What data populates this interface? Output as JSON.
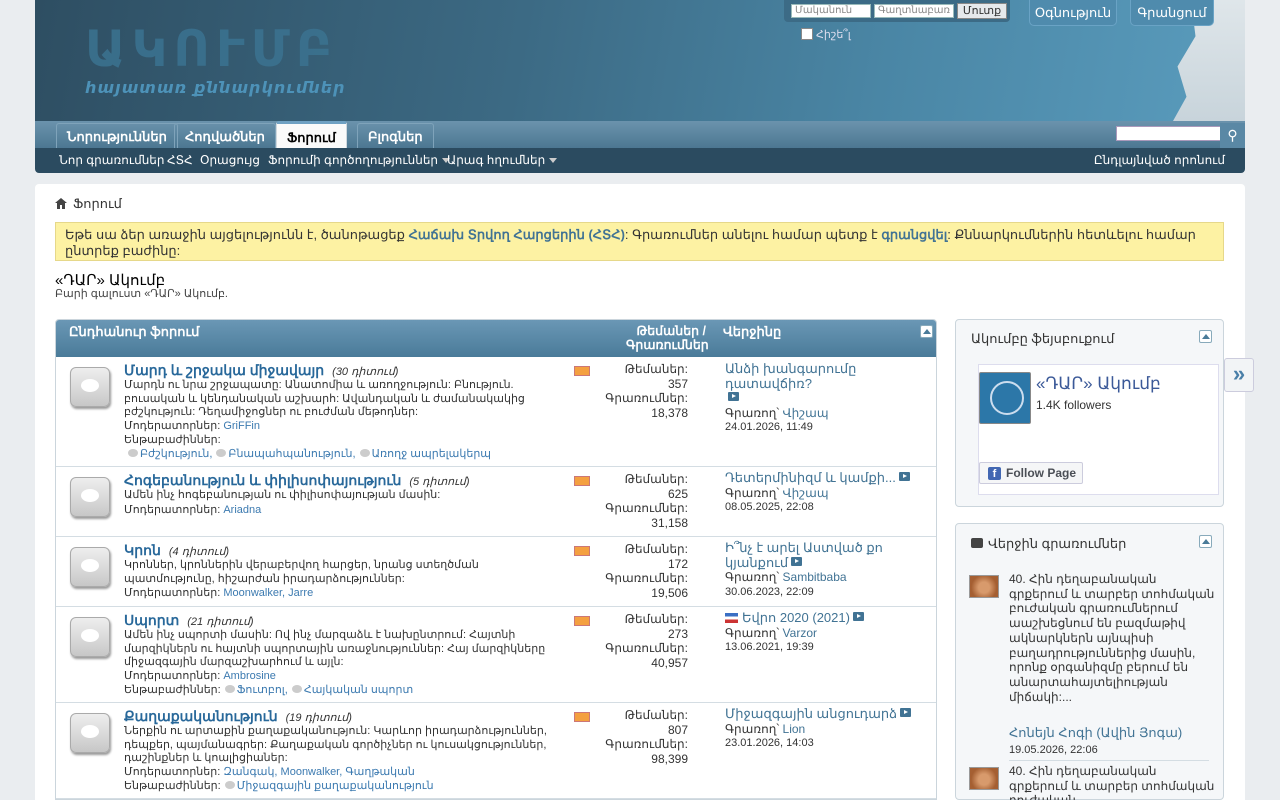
{
  "header": {
    "logo_title": "ԱԿՈՒՄԲ",
    "logo_subtitle": "հայատառ քննարկումներ",
    "login": {
      "username_placeholder": "Մականուն",
      "password_placeholder": "Գաղտնաբառ",
      "login_button": "Մուտք",
      "remember_label": "Հիշե՞լ"
    },
    "help_button": "Օգնություն",
    "register_button": "Գրանցում"
  },
  "nav": {
    "tabs": [
      "Նորություններ",
      "Հոդվածներ",
      "Ֆորում",
      "Բլոգներ"
    ],
    "selected": "Ֆորում",
    "subnav": [
      "Նոր գրառումներ",
      "ՀՏՀ",
      "Օրացույց",
      "Ֆորումի գործողություններ",
      "Արագ հղումներ"
    ],
    "subnav_right": "Ընդլայնված որոնում"
  },
  "breadcrumb": "Ֆորում",
  "notice": {
    "part1": "Եթե սա ձեր առաջին այցելությունն է, ծանոթացեք ",
    "faq_link": "Հաճախ Տրվող Հարցերին (ՀՏՀ)",
    "part2": ": Գրառումներ անելու համար պետք է ",
    "register_link": "գրանցվել",
    "part3": ": Քննարկումներին հետևելու համար ընտրեք բաժինը:"
  },
  "forum_title": "«ԴԱՐ» Ակումբ",
  "welcome_text": "Բարի գալուստ «ԴԱՐ» Ակումբ.",
  "forumlist": {
    "header_title": "Ընդհանուր ֆորում",
    "header_stats": "Թեմաներ / Գրառումներ",
    "header_last": "Վերջինը",
    "topics_label": "Թեմաներ:",
    "posts_label": "Գրառումներ:",
    "moderators_label": "Մոդերատորներ:",
    "subforums_label": "Ենթաբաժիններ:",
    "by_label": "Գրառող՝",
    "rows": [
      {
        "name": "Մարդ և շրջակա միջավայր",
        "viewing": "(30 դիտում)",
        "desc": "Մարդն ու նրա շրջապատը: Անատոմիա և առողջություն: Բնություն. բուսական և կենդանական աշխարհ: Ավանդական և ժամանակակից բժշկություն: Դեղամիջոցներ ու բուժման մեթոդներ:",
        "moderators": "GriFFin",
        "subforums": [
          "Բժշկություն,",
          "Բնապահպանություն,",
          "Առողջ ապրելակերպ"
        ],
        "topics": "357",
        "posts": "18,378",
        "last_title": "Անձի խանգարումը դատավճիռ?",
        "last_user": "Վիշապ",
        "last_date": "24.01.2026, 11:49"
      },
      {
        "name": "Հոգեբանություն և փիլիսոփայություն",
        "viewing": "(5 դիտում)",
        "desc": "Ամեն ինչ հոգեբանության ու փիլիսոփայության մասին:",
        "moderators": "Ariadna",
        "subforums": [],
        "topics": "625",
        "posts": "31,158",
        "last_title": "Դետերմինիզմ և կամքի...",
        "last_user": "Վիշապ",
        "last_date": "08.05.2025, 22:08"
      },
      {
        "name": "Կրոն",
        "viewing": "(4 դիտում)",
        "desc": "Կրոններ, կրոններին վերաբերվող հարցեր, նրանց ստեղծման պատմությունը, հիշարժան իրադարձություններ:",
        "moderators": "Moonwalker, Jarre",
        "subforums": [],
        "topics": "172",
        "posts": "19,506",
        "last_title": "Ի՞նչ է արել Աստված քո կյանքում",
        "last_user": "Sambitbaba",
        "last_date": "30.06.2023, 22:09"
      },
      {
        "name": "Սպորտ",
        "viewing": "(21 դիտում)",
        "desc": "Ամեն ինչ սպորտի մասին: Ով ինչ մարզաձև է նախընտրում: Հայտնի մարզիկներն ու հայտնի սպորտային առաջնություններ: Հայ մարզիկները միջազգային մարզաշխարհում և այլն:",
        "moderators": "Ambrosine",
        "subforums": [
          "Ֆուտբոլ,",
          "Հայկական սպորտ"
        ],
        "topics": "273",
        "posts": "40,957",
        "last_title": "Եվրո 2020 (2021)",
        "last_user": "Varzor",
        "last_date": "13.06.2021, 19:39"
      },
      {
        "name": "Քաղաքականություն",
        "viewing": "(19 դիտում)",
        "desc": "Ներքին ու արտաքին քաղաքականություն: Կարևոր իրադարձություններ, դեպքեր, պայմանագրեր: Քաղաքական գործիչներ ու կուսակցություններ, դաշինքներ և կոալիցիաներ:",
        "moderators": "Զանգակ, Moonwalker, Գաղթական",
        "subforums": [
          "Միջազգային քաղաքականություն"
        ],
        "topics": "807",
        "posts": "98,399",
        "last_title": "Միջազգային անցուդարձ",
        "last_user": "Lion",
        "last_date": "23.01.2026, 14:03"
      }
    ]
  },
  "sidebar": {
    "facebook": {
      "title": "Ակումբը ֆեյսբուքում",
      "page_name": "«ԴԱՐ» Ակումբ",
      "followers": "1.4K followers",
      "follow_button": "Follow Page"
    },
    "recent": {
      "title": "Վերջին գրառումներ",
      "items": [
        {
          "text": "40. Հին դեղաբանական գրքերում և տարբեր տոհմական բուժական գրառումներում աաշխեցնում են բազմաթիվ ակնարկներն այնպիսի բաղադրություններից մասին, որոնք օրգանիզմը բերում են անարտահայտելիության միճակի:...",
          "author": "Հոնեյն Հոգի (Ավին Յոգա)",
          "date": "19.05.2026, 22:06"
        },
        {
          "text": "40. Հին դեղաբանական գրքերում և տարբեր տոհմական բուժական",
          "author": "",
          "date": ""
        }
      ]
    }
  },
  "colors": {
    "accent": "#417394",
    "header_bg": "#3c6a84",
    "navbar": "#4c7792",
    "subnav": "#2b4b60",
    "notice_bg": "#fdf2a3"
  }
}
